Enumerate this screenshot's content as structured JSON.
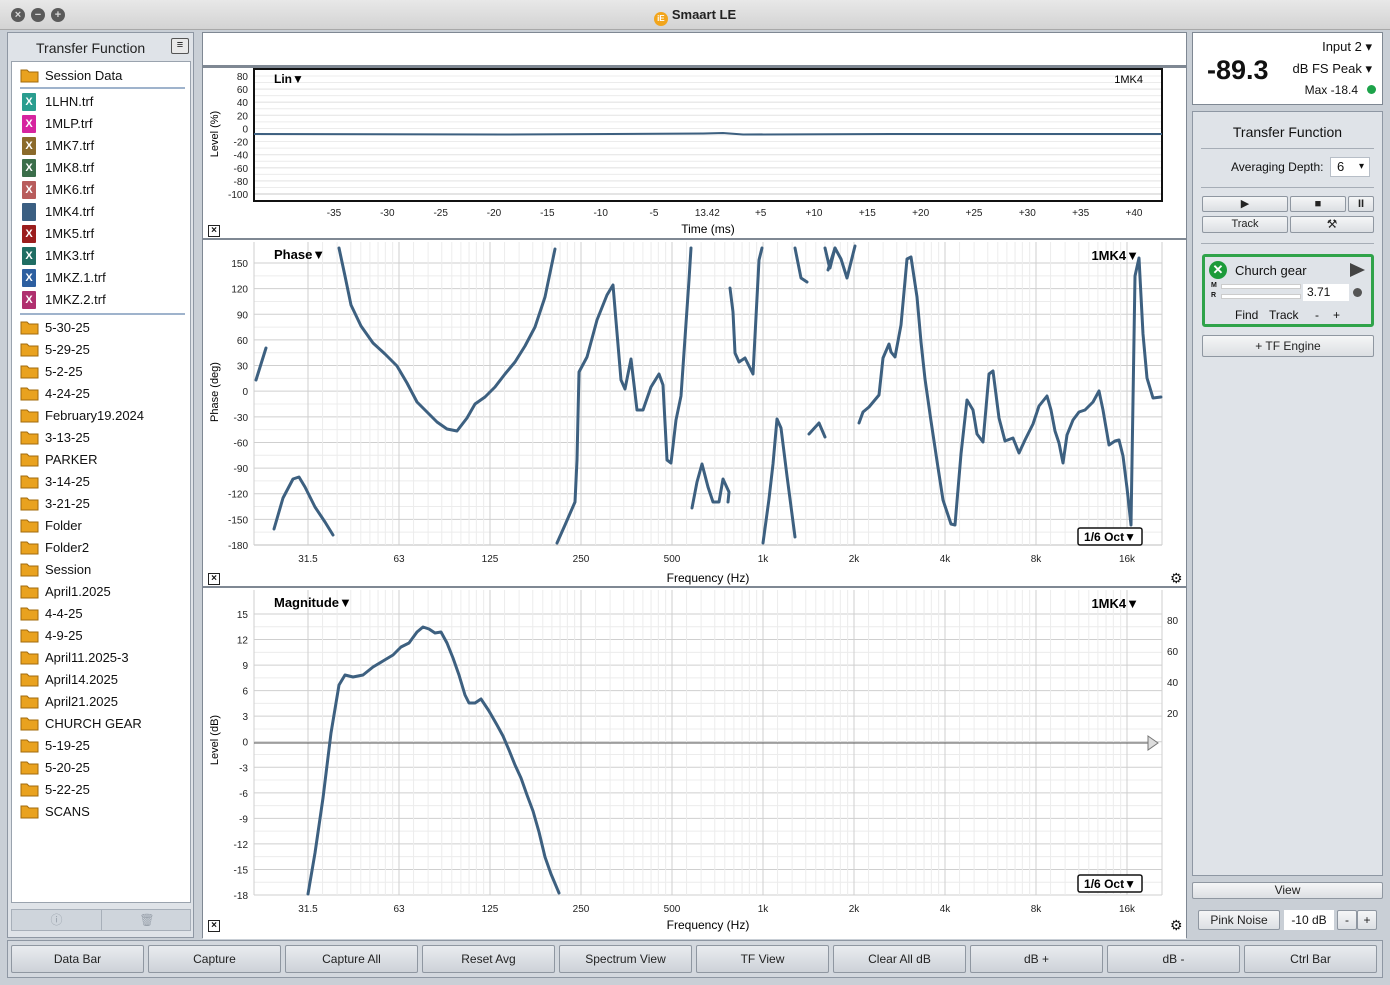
{
  "window": {
    "title": "Smaart LE",
    "logo_text": "iE"
  },
  "sidebar": {
    "title": "Transfer Function",
    "menu_icon": "hamburger-icon",
    "session_label": "Session Data",
    "files": [
      {
        "name": "1LHN.trf",
        "color": "#2a9d8f"
      },
      {
        "name": "1MLP.trf",
        "color": "#d6249f"
      },
      {
        "name": "1MK7.trf",
        "color": "#8b6a2b"
      },
      {
        "name": "1MK8.trf",
        "color": "#3b6e4a"
      },
      {
        "name": "1MK6.trf",
        "color": "#b85c5c"
      },
      {
        "name": "1MK4.trf",
        "color": "#3b5f82"
      },
      {
        "name": "1MK5.trf",
        "color": "#9b1d1d"
      },
      {
        "name": "1MK3.trf",
        "color": "#1f6d63"
      },
      {
        "name": "1MKZ.1.trf",
        "color": "#2d5fa0"
      },
      {
        "name": "1MKZ.2.trf",
        "color": "#b0306f"
      }
    ],
    "folders": [
      "5-30-25",
      "5-29-25",
      "5-2-25",
      "4-24-25",
      "February19.2024",
      "3-13-25",
      "PARKER",
      "3-14-25",
      "3-21-25",
      "Folder",
      "Folder2",
      "Session",
      "April1.2025",
      "4-4-25",
      "4-9-25",
      "April11.2025-3",
      "April14.2025",
      "April21.2025",
      "CHURCH GEAR",
      "5-19-25",
      "5-20-25",
      "5-22-25",
      "SCANS"
    ],
    "footer": {
      "info_icon": "ⓘ",
      "trash_icon": "🗑"
    }
  },
  "plots": {
    "impulse": {
      "mode_label": "Lin▼",
      "trace_label": "1MK4",
      "ylabel": "Level (%)",
      "xlabel": "Time (ms)",
      "yticks": [
        "80",
        "60",
        "40",
        "20",
        "0",
        "-20",
        "-40",
        "-60",
        "-80",
        "-100"
      ],
      "xticks": [
        "-35",
        "-30",
        "-25",
        "-20",
        "-15",
        "-10",
        "-5",
        "13.42",
        "+5",
        "+10",
        "+15",
        "+20",
        "+25",
        "+30",
        "+35",
        "+40"
      ]
    },
    "phase": {
      "mode_label": "Phase▼",
      "trace_label": "1MK4▼",
      "smoothing_label": "1/6 Oct▼",
      "ylabel": "Phase (deg)",
      "xlabel": "Frequency (Hz)",
      "yticks": [
        "150",
        "120",
        "90",
        "60",
        "30",
        "0",
        "-30",
        "-60",
        "-90",
        "-120",
        "-150",
        "-180"
      ],
      "xticks": [
        "31.5",
        "63",
        "125",
        "250",
        "500",
        "1k",
        "2k",
        "4k",
        "8k",
        "16k"
      ]
    },
    "magnitude": {
      "mode_label": "Magnitude▼",
      "trace_label": "1MK4▼",
      "smoothing_label": "1/6 Oct▼",
      "ylabel": "Level (dB)",
      "xlabel": "Frequency (Hz)",
      "yticks": [
        "15",
        "12",
        "9",
        "6",
        "3",
        "0",
        "-3",
        "-6",
        "-9",
        "-12",
        "-15",
        "-18"
      ],
      "right_ticks": [
        "80",
        "60",
        "40",
        "20"
      ],
      "xticks": [
        "31.5",
        "63",
        "125",
        "250",
        "500",
        "1k",
        "2k",
        "4k",
        "8k",
        "16k"
      ]
    }
  },
  "meter": {
    "value": "-89.3",
    "input": "Input 2",
    "unit": "dB FS Peak",
    "max": "Max -18.4",
    "status_color": "#1da34a"
  },
  "right_panel": {
    "title": "Transfer Function",
    "averaging_label": "Averaging Depth:",
    "averaging_value": "6",
    "track_label": "Track",
    "engine": {
      "name": "Church gear",
      "value": "3.71",
      "find": "Find",
      "track": "Track",
      "minus": "-",
      "plus": "+",
      "m_label": "M",
      "r_label": "R"
    },
    "tf_engine_label": "+ TF Engine",
    "view_label": "View",
    "pink_noise_label": "Pink Noise",
    "noise_level": "-10 dB",
    "minus": "-",
    "plus": "+"
  },
  "toolbar": [
    "Data Bar",
    "Capture",
    "Capture All",
    "Reset Avg",
    "Spectrum View",
    "TF View",
    "Clear All dB",
    "dB +",
    "dB -",
    "Ctrl Bar"
  ],
  "colors": {
    "trace": "#3d6080",
    "accent_green": "#2fa34a",
    "folder": "#e9a21f"
  }
}
